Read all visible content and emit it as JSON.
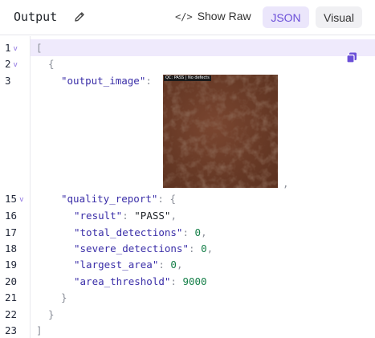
{
  "header": {
    "title": "Output",
    "show_raw_icon": "</>",
    "show_raw_label": "Show Raw",
    "json_tab": "JSON",
    "visual_tab": "Visual"
  },
  "icons": {
    "edit": "pencil-icon",
    "copy": "copy-icon",
    "fold": "chevron-down-icon"
  },
  "colors": {
    "accent": "#6b4fd8",
    "key": "#3a2ea8",
    "number": "#17804a",
    "active_line": "#efeafc"
  },
  "editor": {
    "line_numbers": [
      "1",
      "2",
      "3",
      "15",
      "16",
      "17",
      "18",
      "19",
      "20",
      "21",
      "22",
      "23"
    ],
    "fold_marker": "v",
    "open_bracket": "[",
    "open_brace": "{",
    "output_image_key": "\"output_image\"",
    "image_label": "QC: PASS | No defects",
    "after_image": ",",
    "quality_report_key": "\"quality_report\"",
    "result_key": "\"result\"",
    "result_value": "\"PASS\"",
    "total_detections_key": "\"total_detections\"",
    "total_detections_value": "0",
    "severe_detections_key": "\"severe_detections\"",
    "severe_detections_value": "0",
    "largest_area_key": "\"largest_area\"",
    "largest_area_value": "0",
    "area_threshold_key": "\"area_threshold\"",
    "area_threshold_value": "9000",
    "close_brace": "}",
    "close_bracket": "]"
  }
}
